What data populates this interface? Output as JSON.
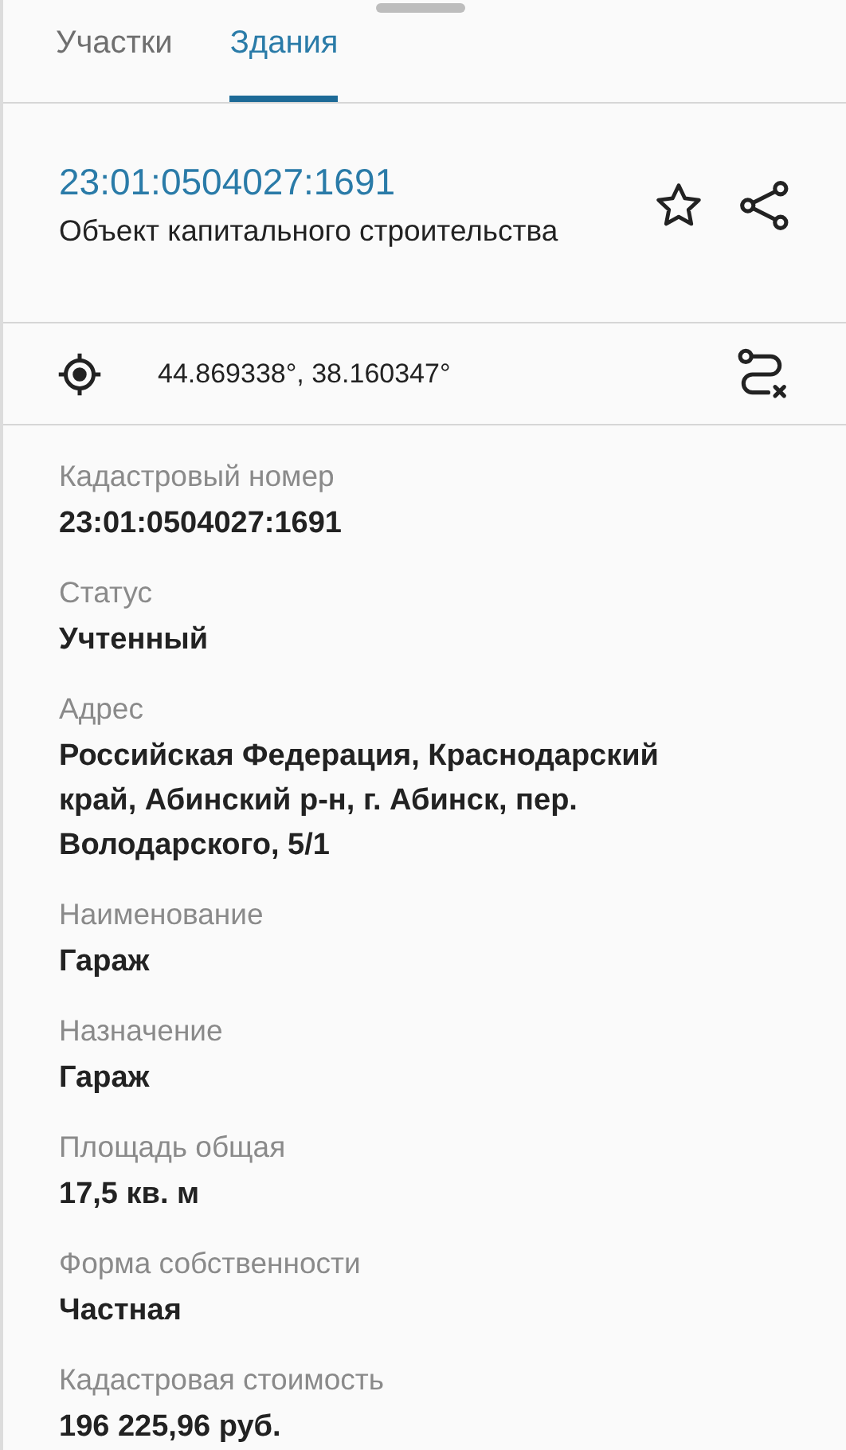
{
  "tabs": [
    {
      "label": "Участки",
      "selected": false
    },
    {
      "label": "Здания",
      "selected": true
    }
  ],
  "header": {
    "cadastral_number": "23:01:0504027:1691",
    "object_type": "Объект капитального строительства",
    "favorite": false
  },
  "coordinates": "44.869338°, 38.160347°",
  "fields": [
    {
      "label": "Кадастровый номер",
      "value": "23:01:0504027:1691"
    },
    {
      "label": "Статус",
      "value": "Учтенный"
    },
    {
      "label": "Адрес",
      "value": "Российская Федерация, Краснодарский край, Абинский р-н, г. Абинск, пер. Володарского, 5/1"
    },
    {
      "label": "Наименование",
      "value": "Гараж"
    },
    {
      "label": "Назначение",
      "value": "Гараж"
    },
    {
      "label": "Площадь общая",
      "value": "17,5 кв. м"
    },
    {
      "label": "Форма собственности",
      "value": "Частная"
    },
    {
      "label": "Кадастровая стоимость",
      "value": "196 225,96 руб."
    }
  ]
}
